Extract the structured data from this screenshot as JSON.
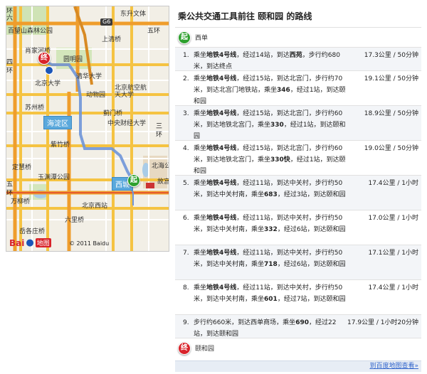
{
  "title": "乘公共交通工具前往 颐和园 的路线",
  "start": {
    "badge": "起",
    "label": "西单"
  },
  "end": {
    "badge": "终",
    "label": "颐和园"
  },
  "routes": [
    {
      "num": "1.",
      "seg": [
        "乘坐",
        "地铁4号线",
        "，经过14站，到达",
        "西苑",
        "，步行约680米，到达终点"
      ],
      "meta": "17.3公里 / 50分钟"
    },
    {
      "num": "2.",
      "seg": [
        "乘坐",
        "地铁4号线",
        "，经过15站，到达北宫门，步行约70米，到达北宫门地铁站，乘坐",
        "346",
        "，经过1站，到达颐和园"
      ],
      "meta": "19.1公里 / 50分钟"
    },
    {
      "num": "3.",
      "seg": [
        "乘坐",
        "地铁4号线",
        "，经过15站，到达北宫门，步行约60米，到达地铁北宫门，乘坐",
        "330",
        "，经过1站，到达颐和园"
      ],
      "meta": "18.9公里 / 50分钟"
    },
    {
      "num": "4.",
      "seg": [
        "乘坐",
        "地铁4号线",
        "，经过15站，到达北宫门，步行约60米，到达地铁北宫门，乘坐",
        "330快",
        "，经过1站，到达颐和园"
      ],
      "meta": "19.0公里 / 50分钟"
    },
    {
      "num": "5.",
      "seg": [
        "乘坐",
        "地铁4号线",
        "，经过11站，到达中关村，步行约50米，到达中关村南，乘坐",
        "683",
        "，经过3站，到达颐和园"
      ],
      "meta": "17.4公里 / 1小时"
    },
    {
      "num": "6.",
      "seg": [
        "乘坐",
        "地铁4号线",
        "，经过11站，到达中关村，步行约50米，到达中关村南，乘坐",
        "332",
        "，经过6站，到达颐和园"
      ],
      "meta": "17.0公里 / 1小时"
    },
    {
      "num": "7.",
      "seg": [
        "乘坐",
        "地铁4号线",
        "，经过11站，到达中关村，步行约50米，到达中关村南，乘坐",
        "718",
        "，经过6站，到达颐和园"
      ],
      "meta": "17.1公里 / 1小时"
    },
    {
      "num": "8.",
      "seg": [
        "乘坐",
        "地铁4号线",
        "，经过11站，到达中关村，步行约50米，到达中关村南，乘坐",
        "601",
        "，经过7站，到达颐和园"
      ],
      "meta": "17.4公里 / 1小时"
    },
    {
      "num": "9.",
      "seg": [
        "步行约660米，到达西单商场，乘坐",
        "690",
        "，经过22站，到达颐和园",
        "",
        ""
      ],
      "meta": "17.9公里 / 1小时20分钟"
    }
  ],
  "footer_link": "到百度地图查看»",
  "map": {
    "district": "海淀区",
    "district2": "西城",
    "start_badge": "起",
    "end_badge": "终",
    "shield": "G6",
    "logo_bai": "Bai",
    "logo_ditu": "地图",
    "copyright": "© 2011 Baidu",
    "labels": [
      "东升文体",
      "上清桥",
      "百望山森林公园",
      "肖家河桥",
      "圆明园",
      "清华大学",
      "北京大学",
      "北京航空航天大学",
      "苏州桥",
      "蓟门桥",
      "中央财经大学",
      "紫竹桥",
      "北海公",
      "定慧桥",
      "玉渊潭公园",
      "北京西站",
      "六里桥",
      "岳各庄桥",
      "万柳桥",
      "动物园",
      "故宫",
      "四",
      "环",
      "五",
      "环",
      "六",
      "环",
      "五环",
      "三",
      "环"
    ]
  }
}
